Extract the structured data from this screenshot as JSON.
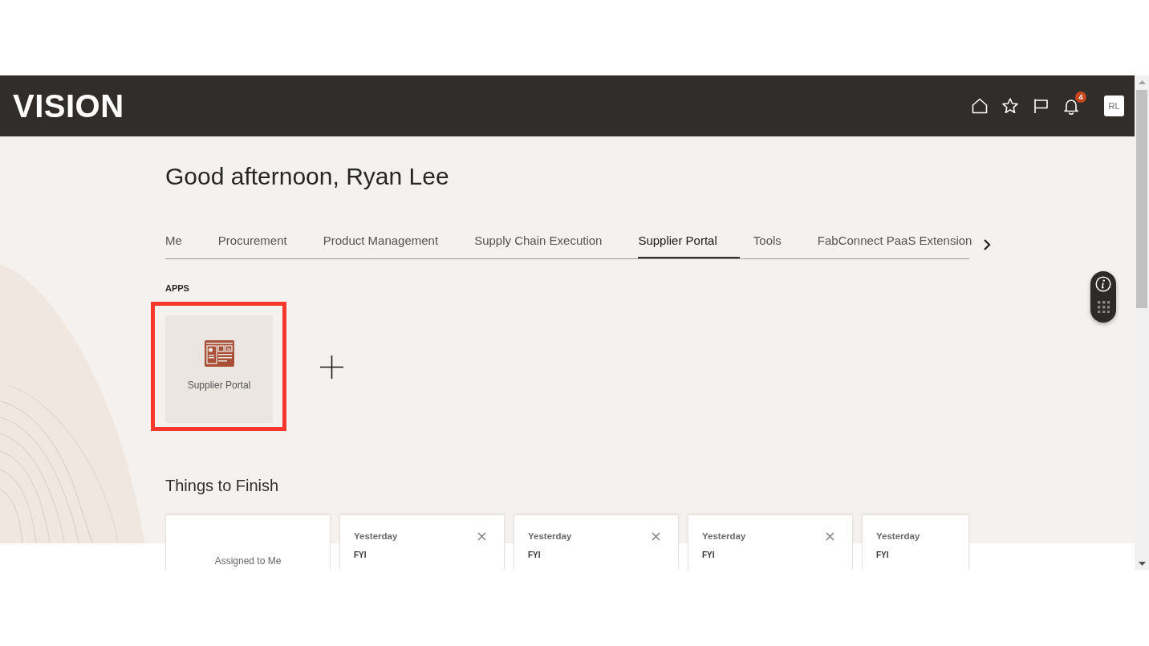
{
  "header": {
    "logo": "VISION",
    "notifications_badge": "4",
    "avatar_initials": "RL"
  },
  "greeting": "Good afternoon, Ryan Lee",
  "tabs": [
    {
      "label": "Me",
      "selected": false
    },
    {
      "label": "Procurement",
      "selected": false
    },
    {
      "label": "Product Management",
      "selected": false
    },
    {
      "label": "Supply Chain Execution",
      "selected": false
    },
    {
      "label": "Supplier Portal",
      "selected": true
    },
    {
      "label": "Tools",
      "selected": false
    },
    {
      "label": "FabConnect PaaS Extension",
      "selected": false
    }
  ],
  "apps_section": {
    "heading": "APPS",
    "apps": [
      {
        "label": "Supplier Portal",
        "highlighted": true
      }
    ]
  },
  "things_to_finish": {
    "heading": "Things to Finish",
    "cards": [
      {
        "kind": "summary",
        "label": "Assigned to Me"
      },
      {
        "kind": "notification",
        "date": "Yesterday",
        "type": "FYI",
        "closable": true
      },
      {
        "kind": "notification",
        "date": "Yesterday",
        "type": "FYI",
        "closable": true
      },
      {
        "kind": "notification",
        "date": "Yesterday",
        "type": "FYI",
        "closable": true
      },
      {
        "kind": "notification",
        "date": "Yesterday",
        "type": "FYI",
        "closable": false
      }
    ]
  }
}
